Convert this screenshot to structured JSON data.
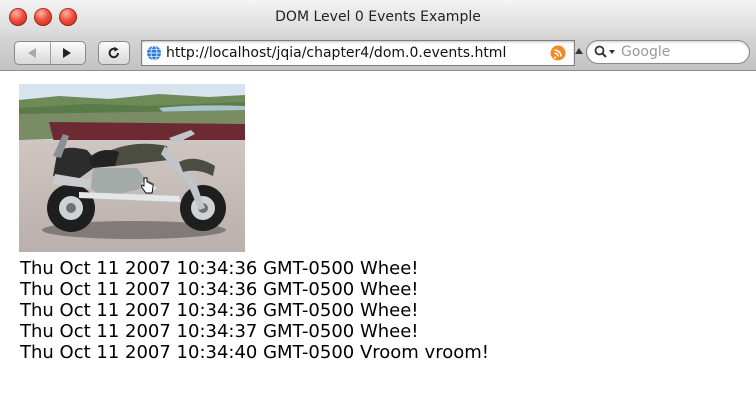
{
  "window": {
    "title": "DOM Level 0 Events Example"
  },
  "toolbar": {
    "url": "http://localhost/jqia/chapter4/dom.0.events.html",
    "search_placeholder": "Google"
  },
  "icons": {
    "close": "close-icon",
    "minimize": "minimize-icon",
    "zoom": "zoom-icon",
    "back": "back-arrow-icon",
    "forward": "forward-arrow-icon",
    "reload": "reload-icon",
    "site": "globe-icon",
    "feed": "rss-icon",
    "search": "search-icon",
    "cursor": "hand-cursor-icon"
  },
  "colors": {
    "traffic_light": "#ee4b3b",
    "url_globe": "#2f7bd6",
    "rss": "#f08a24"
  },
  "log": {
    "lines": [
      "Thu Oct 11 2007 10:34:36 GMT-0500 Whee!",
      "Thu Oct 11 2007 10:34:36 GMT-0500 Whee!",
      "Thu Oct 11 2007 10:34:36 GMT-0500 Whee!",
      "Thu Oct 11 2007 10:34:37 GMT-0500 Whee!",
      "Thu Oct 11 2007 10:34:40 GMT-0500 Vroom vroom!"
    ]
  }
}
